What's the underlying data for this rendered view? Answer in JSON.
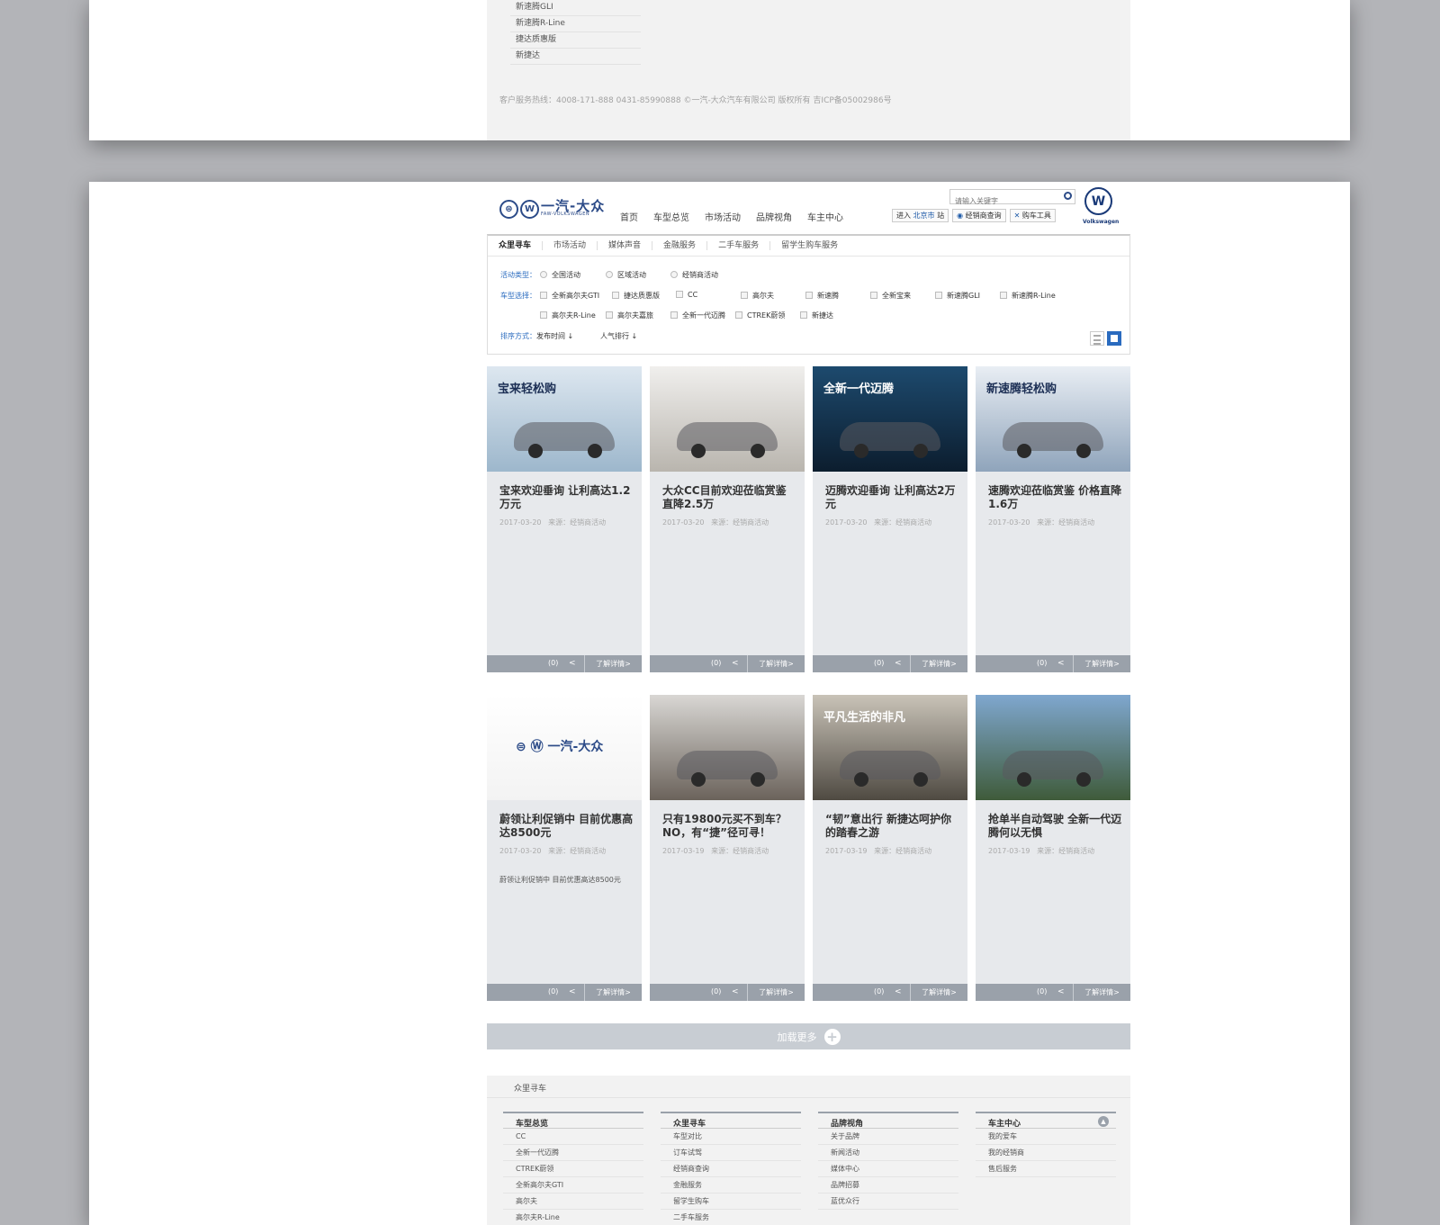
{
  "top_list": [
    "新速腾GLI",
    "新速腾R-Line",
    "捷达质惠版",
    "新捷达"
  ],
  "footer_line": "客户服务热线：4008-171-888 0431-85990888    ©一汽-大众汽车有限公司 版权所有 吉ICP备05002986号",
  "header": {
    "brand_cn": "一汽-大众",
    "brand_en": "FAW-VOLKSWAGEN",
    "nav": [
      "首页",
      "车型总览",
      "市场活动",
      "品牌视角",
      "车主中心"
    ],
    "search_placeholder": "请输入关键字",
    "enter_prefix": "进入",
    "enter_city": "北京市",
    "enter_suffix": "站",
    "dealer_query": "经销商查询",
    "car_tools": "购车工具",
    "vw_label": "Volkswagen"
  },
  "subnav": [
    "众里寻车",
    "市场活动",
    "媒体声音",
    "金融服务",
    "二手车服务",
    "留学生购车服务"
  ],
  "filter": {
    "activity_label": "活动类型：",
    "activity_options": [
      "全国活动",
      "区域活动",
      "经销商活动"
    ],
    "model_label": "车型选择：",
    "model_options_row1": [
      "全新高尔夫GTI",
      "捷达质惠版",
      "CC",
      "高尔夫",
      "新速腾",
      "全新宝来",
      "新速腾GLI",
      "新速腾R-Line"
    ],
    "model_options_row2": [
      "高尔夫R-Line",
      "高尔夫嘉旅",
      "全新一代迈腾",
      "CTREK蔚领",
      "新捷达"
    ],
    "sort_label": "排序方式：",
    "sort_options": [
      "发布时间",
      "人气排行"
    ]
  },
  "cards": [
    {
      "img_text": "宝来轻松购",
      "title": "宝来欢迎垂询 让利高达1.2万元",
      "date": "2017-03-20",
      "source": "来源：经销商活动",
      "desc": "",
      "count": "(0)",
      "more": "了解详情>",
      "img_colors": [
        "#dde7f0",
        "#9db7cc"
      ]
    },
    {
      "img_text": "",
      "title": "大众CC目前欢迎莅临赏鉴 直降2.5万",
      "date": "2017-03-20",
      "source": "来源：经销商活动",
      "desc": "",
      "count": "(0)",
      "more": "了解详情>",
      "img_colors": [
        "#f0efed",
        "#b9b5ae"
      ]
    },
    {
      "img_text": "全新一代迈腾",
      "title": "迈腾欢迎垂询 让利高达2万元",
      "date": "2017-03-20",
      "source": "来源：经销商活动",
      "desc": "",
      "count": "(0)",
      "more": "了解详情>",
      "img_colors": [
        "#1d4a6e",
        "#0c1d2e"
      ]
    },
    {
      "img_text": "新速腾轻松购",
      "title": "速腾欢迎莅临赏鉴 价格直降1.6万",
      "date": "2017-03-20",
      "source": "来源：经销商活动",
      "desc": "",
      "count": "(0)",
      "more": "了解详情>",
      "img_colors": [
        "#e9eef4",
        "#8fa4bb"
      ]
    },
    {
      "img_text": "一汽-大众",
      "title": "蔚领让利促销中 目前优惠高达8500元",
      "date": "2017-03-20",
      "source": "来源：经销商活动",
      "desc": "蔚领让利促销中 目前优惠高达8500元",
      "count": "(0)",
      "more": "了解详情>",
      "img_colors": [
        "#ffffff",
        "#f3f3f3"
      ]
    },
    {
      "img_text": "",
      "title": "只有19800元买不到车？NO，有“捷”径可寻！",
      "date": "2017-03-19",
      "source": "来源：经销商活动",
      "desc": "",
      "count": "(0)",
      "more": "了解详情>",
      "img_colors": [
        "#d9d7d4",
        "#6b635b"
      ]
    },
    {
      "img_text": "平凡生活的非凡",
      "title": "“韧”意出行 新捷达呵护你的踏春之游",
      "date": "2017-03-19",
      "source": "来源：经销商活动",
      "desc": "",
      "count": "(0)",
      "more": "了解详情>",
      "img_colors": [
        "#c9c3b8",
        "#4f4a42"
      ]
    },
    {
      "img_text": "",
      "title": "抢单半自动驾驶 全新一代迈腾何以无惧",
      "date": "2017-03-19",
      "source": "来源：经销商活动",
      "desc": "",
      "count": "(0)",
      "more": "了解详情>",
      "img_colors": [
        "#7fa7cf",
        "#3f5b3a"
      ]
    }
  ],
  "load_more": "加载更多",
  "footer": {
    "title": "众里寻车",
    "columns": [
      {
        "head": "车型总览",
        "items": [
          "CC",
          "全新一代迈腾",
          "CTREK蔚领",
          "全新高尔夫GTI",
          "高尔夫",
          "高尔夫R-Line"
        ]
      },
      {
        "head": "众里寻车",
        "items": [
          "车型对比",
          "订车试驾",
          "经销商查询",
          "金融服务",
          "留学生购车",
          "二手车服务"
        ]
      },
      {
        "head": "品牌视角",
        "items": [
          "关于品牌",
          "新闻活动",
          "媒体中心",
          "品牌招募",
          "蓝优众行"
        ]
      },
      {
        "head": "车主中心",
        "items": [
          "我的爱车",
          "我的经销商",
          "售后服务"
        ]
      }
    ]
  }
}
